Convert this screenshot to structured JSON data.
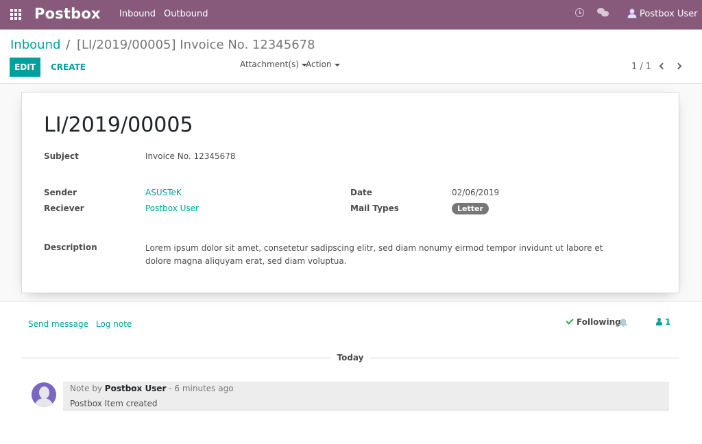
{
  "app": {
    "brand": "Postbox",
    "menu": [
      "Inbound",
      "Outbound"
    ],
    "user_name": "Postbox User",
    "icons": [
      "apps-grid-icon",
      "clock-icon",
      "chat-icon",
      "user-avatar-icon"
    ]
  },
  "breadcrumb": {
    "parent": "Inbound",
    "separator": "/",
    "current": "[LI/2019/00005] Invoice No. 12345678"
  },
  "toolbar": {
    "edit_label": "EDIT",
    "create_label": "CREATE",
    "attachments_label": "Attachment(s)",
    "action_label": "Action"
  },
  "pager": {
    "value": "1 / 1"
  },
  "record": {
    "title": "LI/2019/00005",
    "fields": {
      "subject": {
        "label": "Subject",
        "value": "Invoice No. 12345678"
      },
      "sender": {
        "label": "Sender",
        "value": "ASUSTeK"
      },
      "receiver": {
        "label": "Reciever",
        "value": "Postbox User"
      },
      "date": {
        "label": "Date",
        "value": "02/06/2019"
      },
      "mail_types": {
        "label": "Mail Types",
        "value": "Letter"
      },
      "description": {
        "label": "Description",
        "value": "Lorem ipsum dolor sit amet, consetetur sadipscing elitr, sed diam nonumy eirmod tempor invidunt ut labore et dolore magna aliquyam erat, sed diam voluptua."
      }
    }
  },
  "chatter": {
    "send_message": "Send message",
    "log_note": "Log note",
    "following": "Following",
    "followers_count": "1",
    "date_separator": "Today",
    "messages": [
      {
        "prefix": "Note by",
        "author": "Postbox User",
        "time": "- 6 minutes ago",
        "body": "Postbox Item created"
      }
    ]
  },
  "colors": {
    "navbar": "#875a7b",
    "accent": "#00a09d",
    "badge": "#777777",
    "avatar": "#7b66c4"
  }
}
